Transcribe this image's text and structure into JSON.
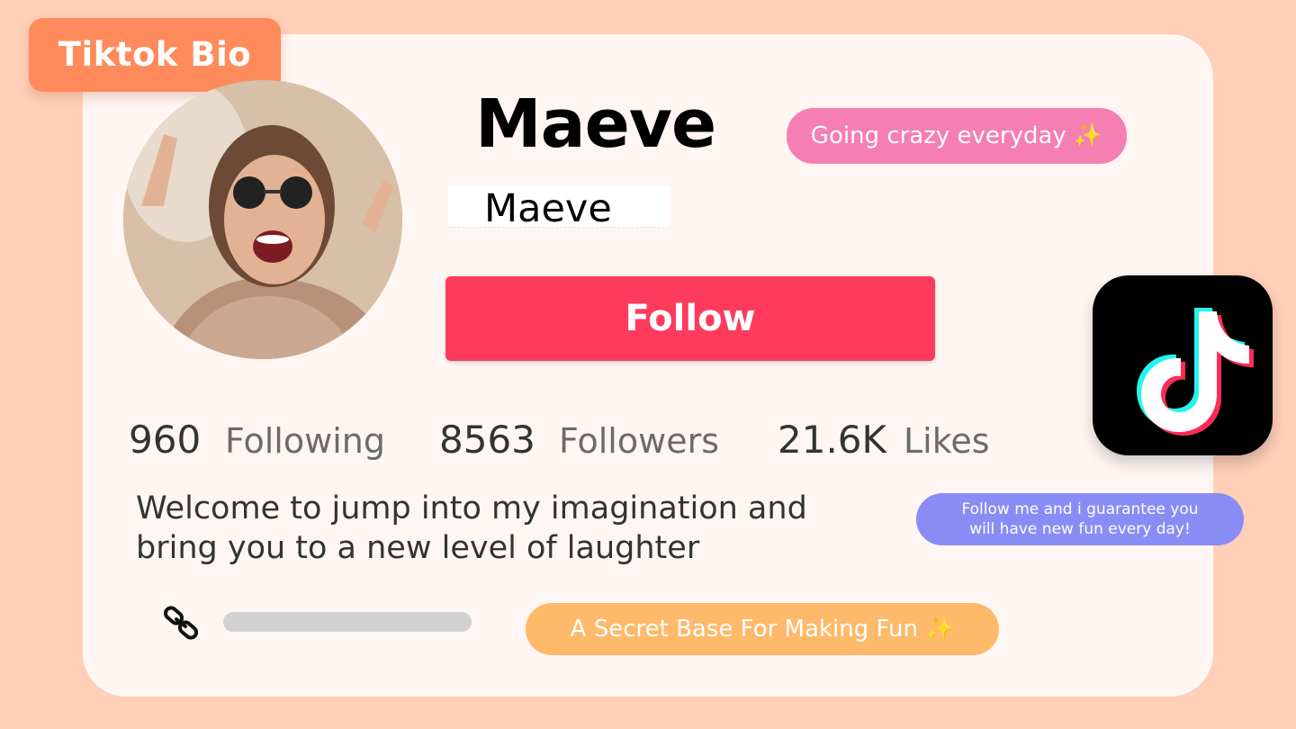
{
  "header": {
    "title": "Tiktok Bio"
  },
  "profile": {
    "display_name": "Maeve",
    "username": "Maeve",
    "follow_label": "Follow",
    "stats": [
      {
        "value": "960",
        "label": "Following"
      },
      {
        "value": "8563",
        "label": "Followers"
      },
      {
        "value": "21.6K",
        "label": "Likes"
      }
    ],
    "bio": "Welcome to jump into my imagination and bring you to a new level of laughter"
  },
  "callouts": {
    "status": "Going crazy everyday",
    "promo_line1": "Follow me and i guarantee you",
    "promo_line2": "will have new fun every day!",
    "tagline": "A Secret Base For Making Fun"
  },
  "icons": {
    "sparkle": "✨",
    "link": "link-icon",
    "brand": "tiktok-logo-icon"
  },
  "colors": {
    "accent_follow": "#fe3b5c",
    "title_badge": "#ff8a5b",
    "pill_pink": "#f57eb3",
    "pill_blue": "#8a8cf6",
    "pill_orange": "#ffb96b",
    "background": "#ffcfb8"
  }
}
